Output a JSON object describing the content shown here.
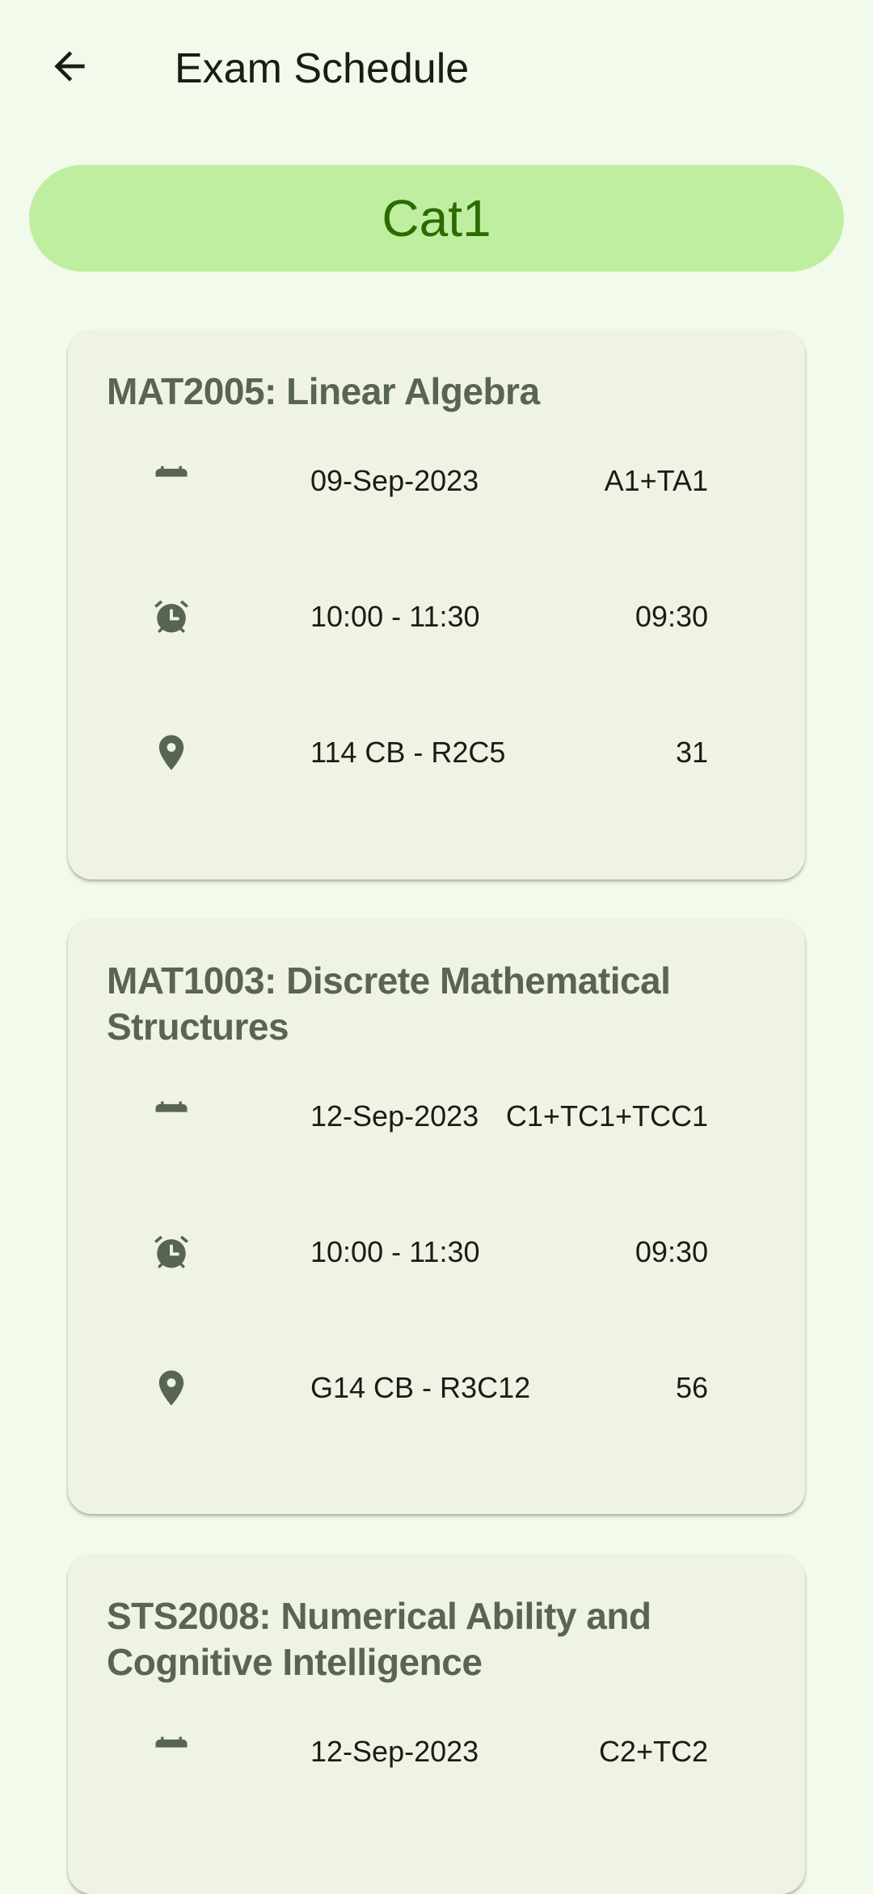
{
  "header": {
    "title": "Exam Schedule",
    "back_icon": "arrow-back-icon"
  },
  "category_chip": "Cat1",
  "colors": {
    "background": "#f2faeb",
    "chip_bg": "#c0eea0",
    "chip_text": "#2a6c00",
    "card_bg": "#eff3e4",
    "card_title": "#586550",
    "icon": "#586550"
  },
  "exams": [
    {
      "title": "MAT2005: Linear Algebra",
      "date": "09-Sep-2023",
      "slot": "A1+TA1",
      "time": "10:00 - 11:30",
      "reporting_time": "09:30",
      "venue": "114 CB - R2C5",
      "seat": "31"
    },
    {
      "title": "MAT1003: Discrete Mathematical Structures",
      "date": "12-Sep-2023",
      "slot": "C1+TC1+TCC1",
      "time": "10:00 - 11:30",
      "reporting_time": "09:30",
      "venue": "G14 CB - R3C12",
      "seat": "56"
    },
    {
      "title": "STS2008: Numerical Ability and Cognitive Intelligence",
      "date": "12-Sep-2023",
      "slot": "C2+TC2",
      "time": "",
      "reporting_time": "",
      "venue": "",
      "seat": ""
    }
  ]
}
